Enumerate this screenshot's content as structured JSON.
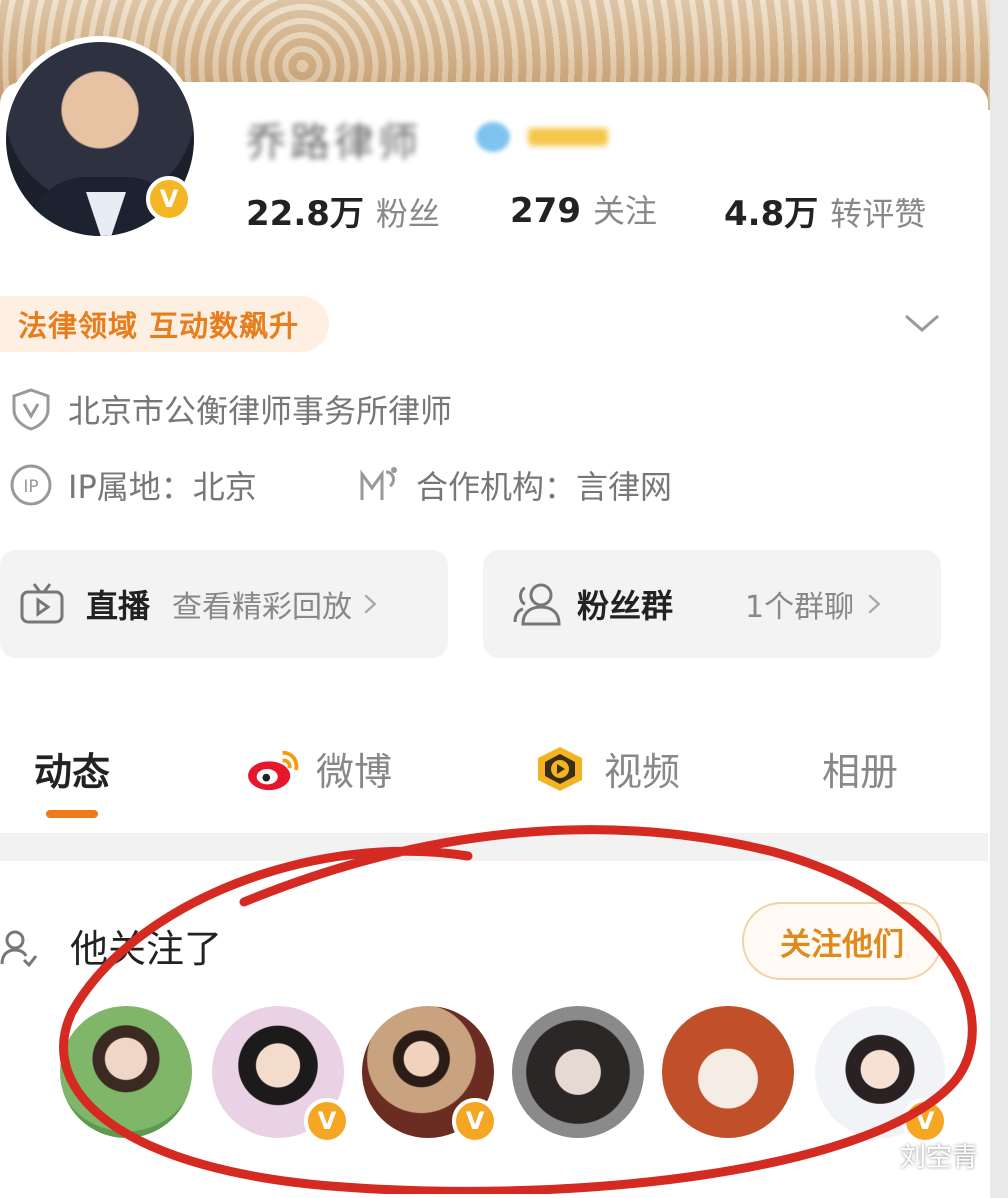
{
  "profile": {
    "name": "乔路律师",
    "stats": [
      {
        "num": "22.8万",
        "label": "粉丝"
      },
      {
        "num": "279",
        "label": "关注"
      },
      {
        "num": "4.8万",
        "label": "转评赞"
      }
    ],
    "tag": "法律领域 互动数飙升",
    "verified_text": "北京市公衡律师事务所律师",
    "ip_label": "IP属地：北京",
    "partner_label": "合作机构：言律网"
  },
  "quick_links": {
    "live": {
      "title": "直播",
      "sub": "查看精彩回放"
    },
    "fan_group": {
      "title": "粉丝群",
      "sub": "1个群聊"
    }
  },
  "tabs": [
    {
      "label": "动态"
    },
    {
      "label": "微博"
    },
    {
      "label": "视频"
    },
    {
      "label": "相册"
    }
  ],
  "following": {
    "title": "他关注了",
    "button": "关注他们"
  },
  "watermark": "刘空青",
  "colors": {
    "accent": "#f07a1a",
    "verified": "#f5b625",
    "annotation_ring": "#d42a22"
  }
}
